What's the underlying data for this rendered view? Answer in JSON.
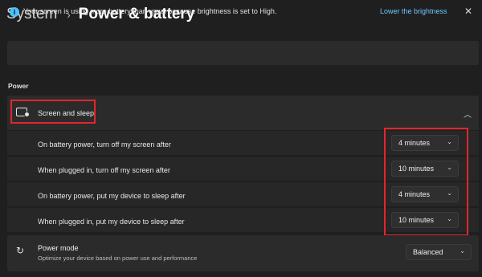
{
  "breadcrumb": {
    "parent": "System",
    "separator": "›",
    "current": "Power & battery"
  },
  "infobar": {
    "icon": "info-icon",
    "icon_glyph": "i",
    "message": "Your screen is using more battery than usual because brightness is set to High.",
    "link": "Lower the brightness",
    "close_glyph": "✕"
  },
  "section": {
    "label": "Power"
  },
  "screen_sleep": {
    "title": "Screen and sleep",
    "expanded": true,
    "chevron_glyph": "︿",
    "rows": [
      {
        "label": "On battery power, turn off my screen after",
        "value": "4 minutes"
      },
      {
        "label": "When plugged in, turn off my screen after",
        "value": "10 minutes"
      },
      {
        "label": "On battery power, put my device to sleep after",
        "value": "4 minutes"
      },
      {
        "label": "When plugged in, put my device to sleep after",
        "value": "10 minutes"
      }
    ]
  },
  "power_mode": {
    "title": "Power mode",
    "description": "Optimize your device based on power use and performance",
    "value": "Balanced",
    "icon_glyph": "↻"
  },
  "dropdown_chevron": "⌄",
  "colors": {
    "background": "#1f1f1f",
    "card": "#2b2b2b",
    "accent": "#4cc2ff",
    "link": "#6fc7ff",
    "highlight": "#e2262c"
  }
}
